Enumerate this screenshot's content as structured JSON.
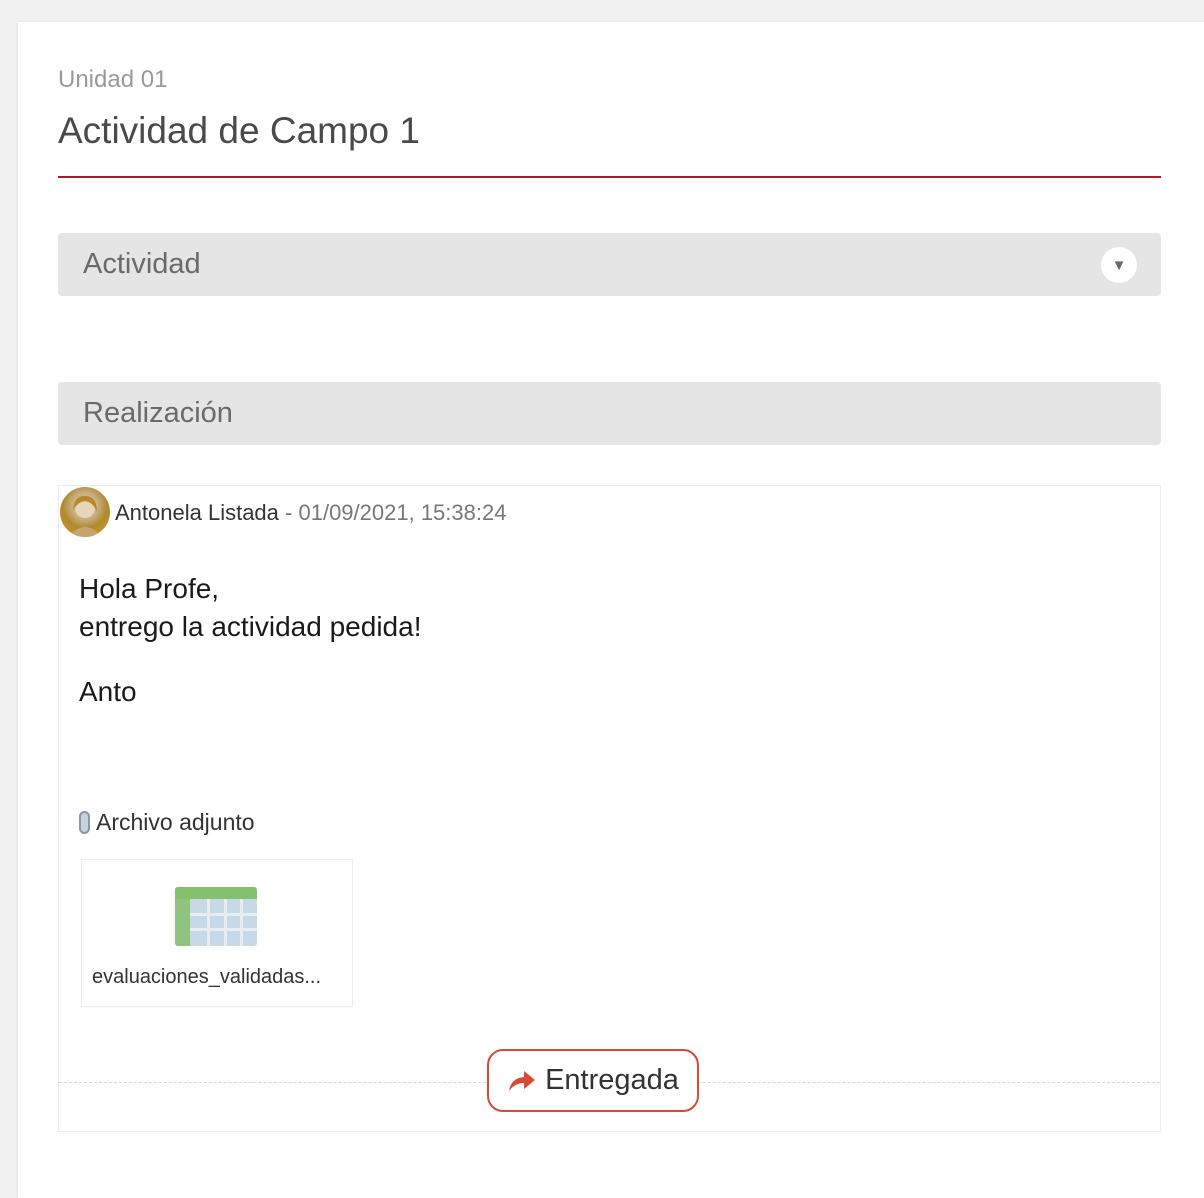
{
  "header": {
    "unit": "Unidad 01",
    "title": "Actividad de Campo 1"
  },
  "sections": {
    "activity": {
      "label": "Actividad",
      "toggle_icon": "triangle-down-icon"
    },
    "submission": {
      "label": "Realización"
    }
  },
  "post": {
    "author": "Antonela Listada",
    "separator": "-",
    "datetime": "01/09/2021, 15:38:24",
    "body_lines": [
      "Hola Profe,",
      "entrego la actividad pedida!"
    ],
    "signoff": "Anto",
    "attachment_label": "Archivo adjunto",
    "attachment_icon": "paperclip-icon",
    "file": {
      "name": "evaluaciones_validadas...",
      "icon": "spreadsheet-icon"
    },
    "status": {
      "label": "Entregada",
      "icon": "share-arrow-icon",
      "color": "#d84a36"
    }
  },
  "colors": {
    "accent": "#b01b22",
    "section_bg": "#e5e5e5"
  }
}
